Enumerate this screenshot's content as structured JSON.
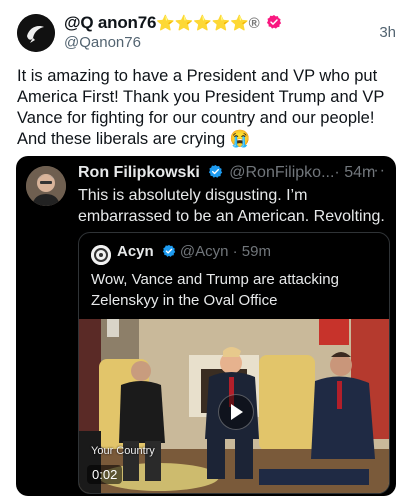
{
  "post": {
    "display_name": "@Q anon76",
    "badges": "⭐⭐⭐⭐⭐",
    "registered_mark": "®",
    "handle": "@Qanon76",
    "time": "3h",
    "text": "It is amazing to have a President and VP who put America First! Thank you President Trump and VP Vance for fighting for our country and our people! And these liberals are crying 😭"
  },
  "quote": {
    "name": "Ron Filipkowski",
    "handle": "@RonFilipko...",
    "time": "· 54m",
    "more": "···",
    "text": "This is absolutely disgusting. I’m embarrassed to be an American. Revolting."
  },
  "inner_quote": {
    "name": "Acyn",
    "handle": "@Acyn · 59m",
    "text": "Wow, Vance and Trump are attacking Zelenskyy in the Oval Office"
  },
  "video": {
    "label": "Your Country",
    "duration": "0:02"
  },
  "colors": {
    "verified_pink": "#f91880",
    "verified_blue": "#1d9bf0",
    "card_bg": "#000000"
  },
  "icons": [
    "verified-icon",
    "play-icon",
    "more-icon"
  ]
}
